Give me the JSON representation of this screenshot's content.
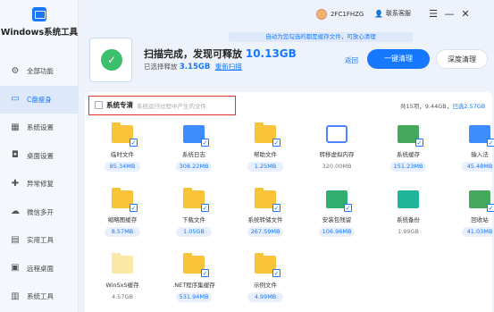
{
  "app": {
    "title": "Windows系统工具"
  },
  "nav": [
    {
      "label": "全部功能",
      "icon": "gear-icon"
    },
    {
      "label": "C盘瘦身",
      "icon": "drive-icon",
      "active": true
    },
    {
      "label": "系统设置",
      "icon": "grid-icon"
    },
    {
      "label": "桌面设置",
      "icon": "desktop-icon"
    },
    {
      "label": "异常修复",
      "icon": "repair-icon"
    },
    {
      "label": "微信多开",
      "icon": "wechat-icon"
    },
    {
      "label": "实用工具",
      "icon": "toolbox-icon"
    },
    {
      "label": "远程桌面",
      "icon": "remote-icon"
    },
    {
      "label": "系统工具",
      "icon": "tools-icon"
    }
  ],
  "topbar": {
    "user": "2FC1FHZG",
    "service": "联系客服",
    "tip": "自动为您勾选的都是缓存文件，可放心清理"
  },
  "scan": {
    "title_prefix": "扫描完成，发现可释放",
    "amount": "10.13GB",
    "selected_prefix": "已选择释放",
    "selected_size": "3.15GB",
    "rescan": "重新扫描",
    "back": "返回",
    "clean": "一键清理",
    "deep_clean": "深度清理"
  },
  "system_section": {
    "label": "系统专清",
    "desc": "系统运行过程中产生的文件",
    "summary_prefix": "共15项，9.44GB，",
    "summary_selected": "已选2.57GB"
  },
  "items": [
    {
      "name": "临时文件",
      "size": "85.34MB",
      "checked": true,
      "icon": "yellow"
    },
    {
      "name": "系统日志",
      "size": "308.22MB",
      "checked": true,
      "icon": "blue"
    },
    {
      "name": "帮助文件",
      "size": "1.25MB",
      "checked": true,
      "icon": "yellow"
    },
    {
      "name": "转移虚拟内存",
      "size": "320.00MB",
      "checked": false,
      "icon": "chip"
    },
    {
      "name": "系统缓存",
      "size": "151.23MB",
      "checked": true,
      "icon": "green"
    },
    {
      "name": "输入法",
      "size": "45.48MB",
      "checked": true,
      "icon": "blue"
    },
    {
      "name": "缩略图缓存",
      "size": "8.57MB",
      "checked": true,
      "icon": "yellow"
    },
    {
      "name": "下载文件",
      "size": "1.05GB",
      "checked": true,
      "icon": "yellow"
    },
    {
      "name": "系统转储文件",
      "size": "267.59MB",
      "checked": true,
      "icon": "yellow"
    },
    {
      "name": "安装包残留",
      "size": "106.96MB",
      "checked": true,
      "icon": "green2"
    },
    {
      "name": "系统备份",
      "size": "1.99GB",
      "checked": false,
      "icon": "teal"
    },
    {
      "name": "回收站",
      "size": "41.03MB",
      "checked": true,
      "icon": "green"
    },
    {
      "name": "WinSxS缓存",
      "size": "4.57GB",
      "checked": false,
      "icon": "pale"
    },
    {
      "name": ".NET程序集缓存",
      "size": "531.94MB",
      "checked": true,
      "icon": "yellow"
    },
    {
      "name": "示例文件",
      "size": "4.99MB",
      "checked": true,
      "icon": "yellow"
    }
  ],
  "colors": {
    "accent": "#1677ff",
    "highlight_border": "#e0342a"
  }
}
